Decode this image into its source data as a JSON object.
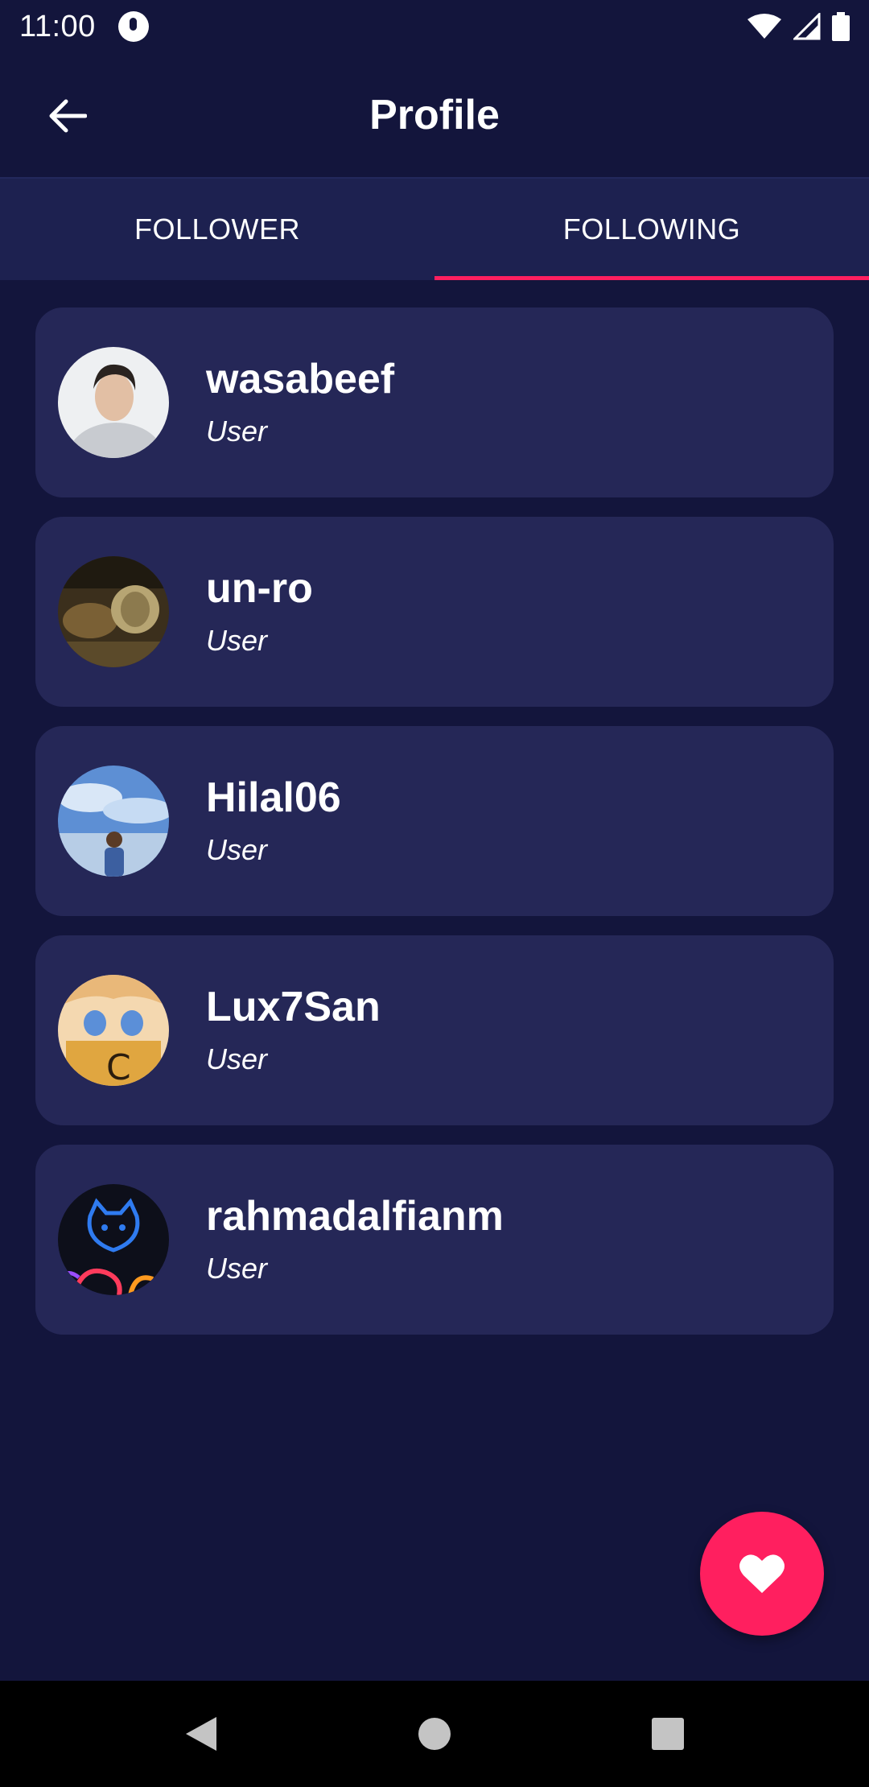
{
  "status_bar": {
    "time": "11:00",
    "icons": [
      "notification-icon",
      "wifi-icon",
      "signal-icon",
      "battery-icon"
    ]
  },
  "app_bar": {
    "title": "Profile",
    "back_icon": "arrow-left-icon"
  },
  "tabs": [
    {
      "label": "FOLLOWER",
      "active": false
    },
    {
      "label": "FOLLOWING",
      "active": true
    }
  ],
  "users": [
    {
      "name": "wasabeef",
      "role": "User"
    },
    {
      "name": "un-ro",
      "role": "User"
    },
    {
      "name": "Hilal06",
      "role": "User"
    },
    {
      "name": "Lux7San",
      "role": "User"
    },
    {
      "name": "rahmadalfianm",
      "role": "User"
    }
  ],
  "fab": {
    "icon": "heart-icon"
  },
  "nav_bar": {
    "icons": [
      "back-triangle-icon",
      "home-circle-icon",
      "recents-square-icon"
    ]
  },
  "colors": {
    "background": "#13153c",
    "card": "#252757",
    "tab_bar": "#1d2150",
    "accent": "#ff1f5f"
  }
}
